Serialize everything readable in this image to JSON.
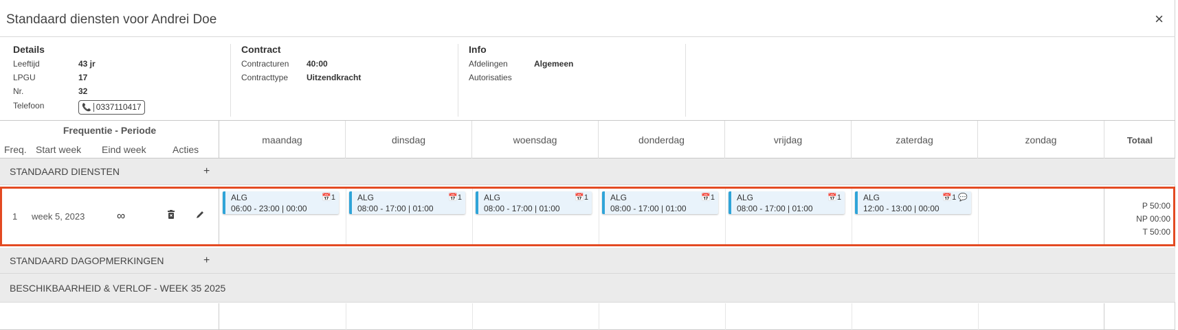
{
  "title": "Standaard diensten voor Andrei Doe",
  "close_label": "×",
  "details": {
    "heading": "Details",
    "rows": [
      {
        "key": "Leeftijd",
        "value": "43 jr"
      },
      {
        "key": "LPGU",
        "value": "17"
      },
      {
        "key": "Nr.",
        "value": "32"
      }
    ],
    "phone_label": "Telefoon",
    "phone_value": "0337110417"
  },
  "contract": {
    "heading": "Contract",
    "rows": [
      {
        "key": "Contracturen",
        "value": "40:00"
      },
      {
        "key": "Contracttype",
        "value": "Uitzendkracht"
      }
    ]
  },
  "info": {
    "heading": "Info",
    "rows": [
      {
        "key": "Afdelingen",
        "value": "Algemeen"
      },
      {
        "key": "Autorisaties",
        "value": ""
      }
    ]
  },
  "grid": {
    "left_title": "Frequentie - Periode",
    "sub_headers": [
      "Freq.",
      "Start week",
      "Eind week",
      "Acties"
    ],
    "days": [
      "maandag",
      "dinsdag",
      "woensdag",
      "donderdag",
      "vrijdag",
      "zaterdag",
      "zondag"
    ],
    "total_header": "Totaal"
  },
  "sections": {
    "standard_shifts": "STANDAARD DIENSTEN",
    "day_notes": "STANDAARD DAGOPMERKINGEN",
    "availability": "BESCHIKBAARHEID & VERLOF - WEEK 35 2025",
    "plus": "+"
  },
  "row": {
    "freq": "1",
    "start_week": "week 5, 2023",
    "end_week": "∞",
    "shifts": [
      {
        "dept": "ALG",
        "time": "06:00 - 23:00  |  00:00",
        "count": "1"
      },
      {
        "dept": "ALG",
        "time": "08:00 - 17:00  |  01:00",
        "count": "1"
      },
      {
        "dept": "ALG",
        "time": "08:00 - 17:00  |  01:00",
        "count": "1"
      },
      {
        "dept": "ALG",
        "time": "08:00 - 17:00  |  01:00",
        "count": "1"
      },
      {
        "dept": "ALG",
        "time": "08:00 - 17:00  |  01:00",
        "count": "1"
      },
      {
        "dept": "ALG",
        "time": "12:00 - 13:00  |  00:00",
        "count": "1"
      }
    ],
    "totals": [
      "P 50:00",
      "NP 00:00",
      "T 50:00"
    ]
  },
  "colors": {
    "accent": "#2fa4d8",
    "highlight": "#e34a22"
  }
}
